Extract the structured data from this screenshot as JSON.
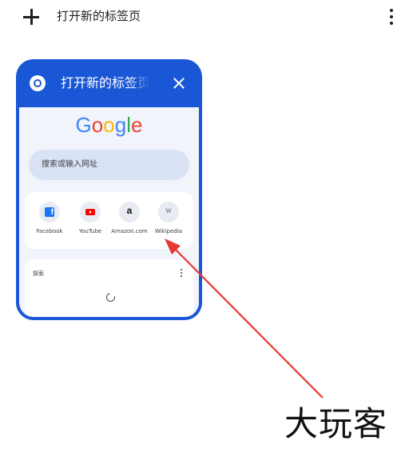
{
  "topbar": {
    "new_tab_icon": "plus-icon",
    "title": "打开新的标签页",
    "menu_icon": "more-vert-icon"
  },
  "tab_card": {
    "icon": "chrome-icon",
    "title": "打开新的标签页",
    "close_icon": "close-icon",
    "accent_color": "#1a57d6",
    "content": {
      "logo_letters": [
        {
          "char": "G",
          "color": "#4285f4"
        },
        {
          "char": "o",
          "color": "#ea4335"
        },
        {
          "char": "o",
          "color": "#fbbc05"
        },
        {
          "char": "g",
          "color": "#4285f4"
        },
        {
          "char": "l",
          "color": "#34a853"
        },
        {
          "char": "e",
          "color": "#ea4335"
        }
      ],
      "search_placeholder": "搜索或输入网址",
      "shortcuts": [
        {
          "label": "Facebook",
          "icon": "facebook-icon"
        },
        {
          "label": "YouTube",
          "icon": "youtube-icon"
        },
        {
          "label": "Amazon.com",
          "icon": "amazon-icon",
          "glyph": "a"
        },
        {
          "label": "Wikipedia",
          "icon": "wikipedia-icon",
          "glyph": "W"
        }
      ],
      "discover": {
        "title": "探索",
        "menu_icon": "more-vert-icon",
        "loading_icon": "spinner-icon"
      }
    }
  },
  "annotation": {
    "arrow_color": "#e53935",
    "watermark": "大玩客"
  }
}
